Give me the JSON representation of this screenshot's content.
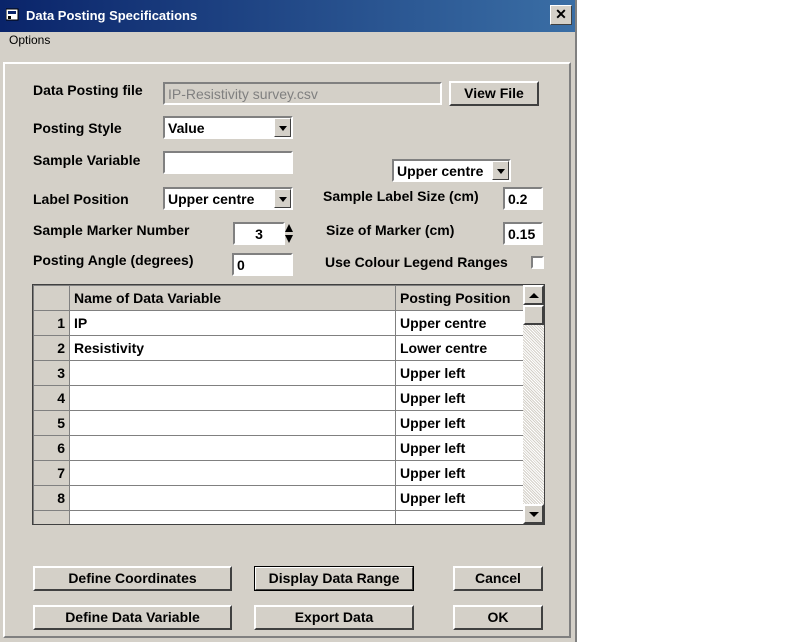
{
  "window": {
    "title": "Data Posting Specifications",
    "close_glyph": "✕"
  },
  "menu": {
    "options": "Options"
  },
  "form": {
    "data_posting_file_label": "Data Posting file",
    "data_posting_file_value": "IP-Resistivity survey.csv",
    "view_file_button": "View File",
    "posting_style_label": "Posting Style",
    "posting_style_value": "Value",
    "sample_variable_label": "Sample Variable",
    "sample_variable_value": "",
    "sample_label_position_value": "Upper centre",
    "label_position_label": "Label Position",
    "label_position_value": "Upper centre",
    "sample_label_size_label": "Sample Label Size (cm)",
    "sample_label_size_value": "0.2",
    "sample_marker_number_label": "Sample Marker Number",
    "sample_marker_number_value": "3",
    "size_of_marker_label": "Size of Marker (cm)",
    "size_of_marker_value": "0.15",
    "posting_angle_label": "Posting Angle (degrees)",
    "posting_angle_value": "0",
    "use_colour_legend_label": "Use Colour Legend Ranges",
    "use_colour_legend_checked": false
  },
  "grid": {
    "headers": [
      "",
      "Name of Data Variable",
      "Posting Position"
    ],
    "rows": [
      {
        "num": "1",
        "name": "IP",
        "position": "Upper centre"
      },
      {
        "num": "2",
        "name": "Resistivity",
        "position": "Lower centre"
      },
      {
        "num": "3",
        "name": "",
        "position": "Upper left"
      },
      {
        "num": "4",
        "name": "",
        "position": "Upper left"
      },
      {
        "num": "5",
        "name": "",
        "position": "Upper left"
      },
      {
        "num": "6",
        "name": "",
        "position": "Upper left"
      },
      {
        "num": "7",
        "name": "",
        "position": "Upper left"
      },
      {
        "num": "8",
        "name": "",
        "position": "Upper left"
      }
    ]
  },
  "buttons": {
    "define_coordinates": "Define Coordinates",
    "display_data_range": "Display Data Range",
    "cancel": "Cancel",
    "define_data_variable": "Define Data Variable",
    "export_data": "Export Data",
    "ok": "OK"
  },
  "colors": {
    "title_start": "#0a246a",
    "title_end": "#3a6ea5",
    "face": "#d4d0c8"
  }
}
